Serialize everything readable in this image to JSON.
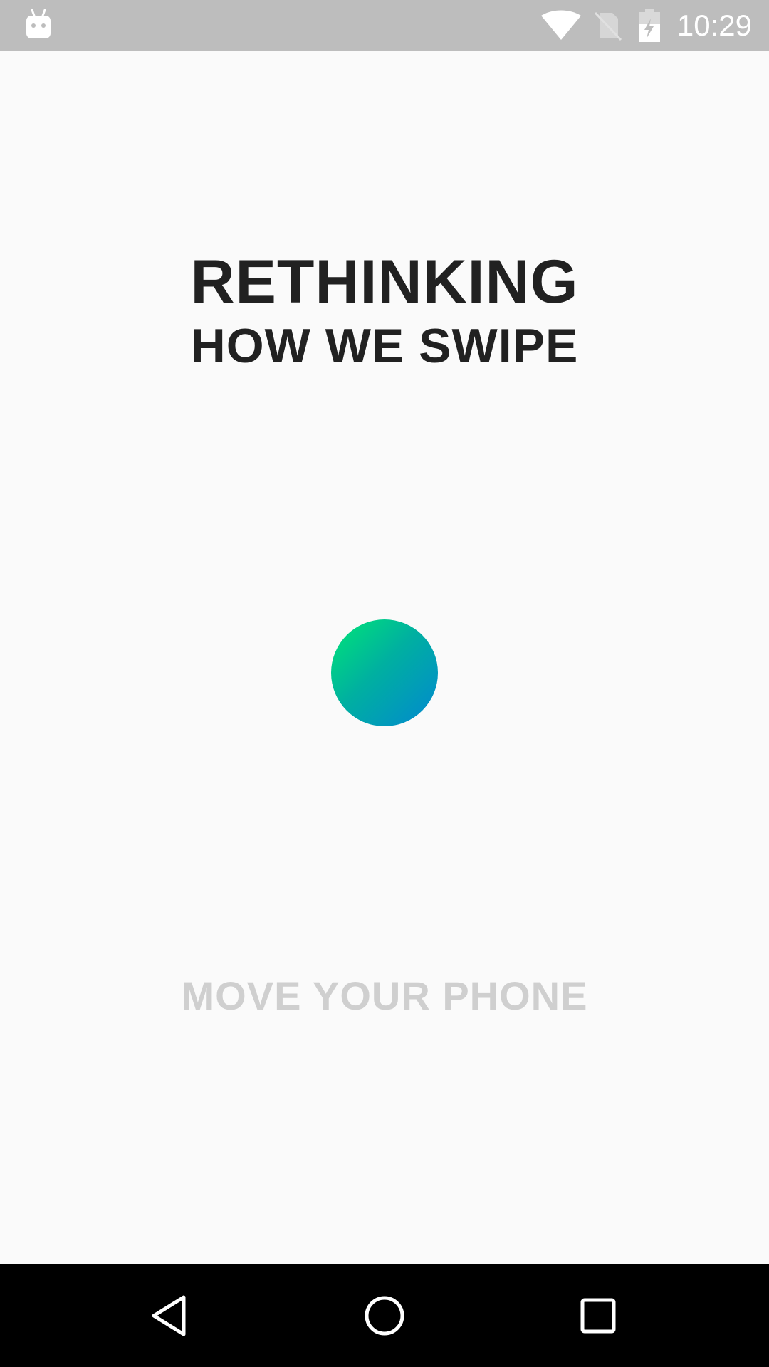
{
  "status_bar": {
    "time": "10:29",
    "icons": [
      "android-icon",
      "wifi-icon",
      "no-sim-icon",
      "battery-charging-icon"
    ]
  },
  "main": {
    "title_line1": "RETHINKING",
    "title_line2": "HOW WE SWIPE",
    "hint": "MOVE YOUR PHONE",
    "orb_gradient": [
      "#00e676",
      "#0288d1"
    ]
  },
  "nav_bar": {
    "buttons": [
      "back-icon",
      "home-icon",
      "recents-icon"
    ]
  },
  "colors": {
    "background": "#fafafa",
    "status_bar": "#bdbdbd",
    "title_text": "#212121",
    "hint_text": "#cfcfcf",
    "nav_bar": "#000000"
  }
}
